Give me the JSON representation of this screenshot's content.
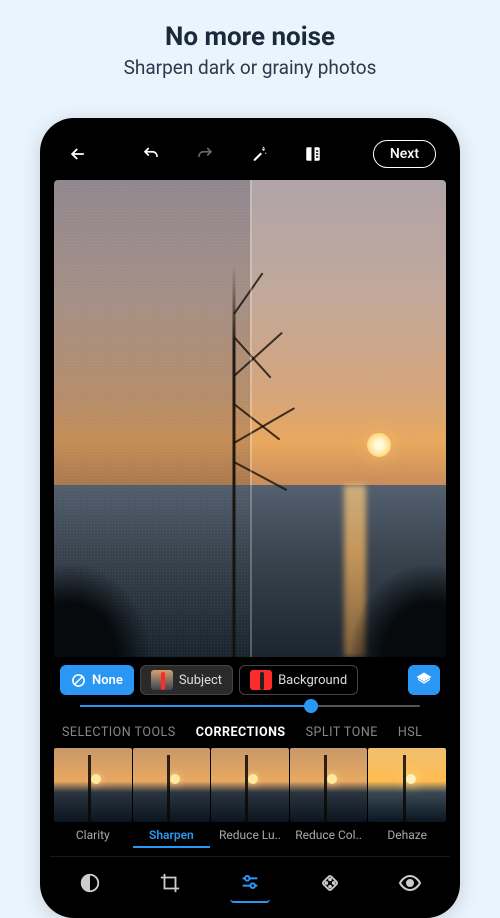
{
  "promo": {
    "title": "No more noise",
    "subtitle": "Sharpen dark or grainy photos"
  },
  "topbar": {
    "next_label": "Next"
  },
  "masks": {
    "none": "None",
    "subject": "Subject",
    "background": "Background"
  },
  "slider": {
    "value": 68
  },
  "categories": {
    "items": [
      "SELECTION TOOLS",
      "CORRECTIONS",
      "SPLIT TONE",
      "HSL"
    ],
    "active": "CORRECTIONS"
  },
  "corrections": {
    "items": [
      {
        "label": "Clarity",
        "active": false
      },
      {
        "label": "Sharpen",
        "active": true
      },
      {
        "label": "Reduce Lu..",
        "active": false
      },
      {
        "label": "Reduce Col..",
        "active": false
      },
      {
        "label": "Dehaze",
        "active": false,
        "variant": "dehaze"
      }
    ]
  },
  "colors": {
    "accent": "#2a97f5"
  }
}
